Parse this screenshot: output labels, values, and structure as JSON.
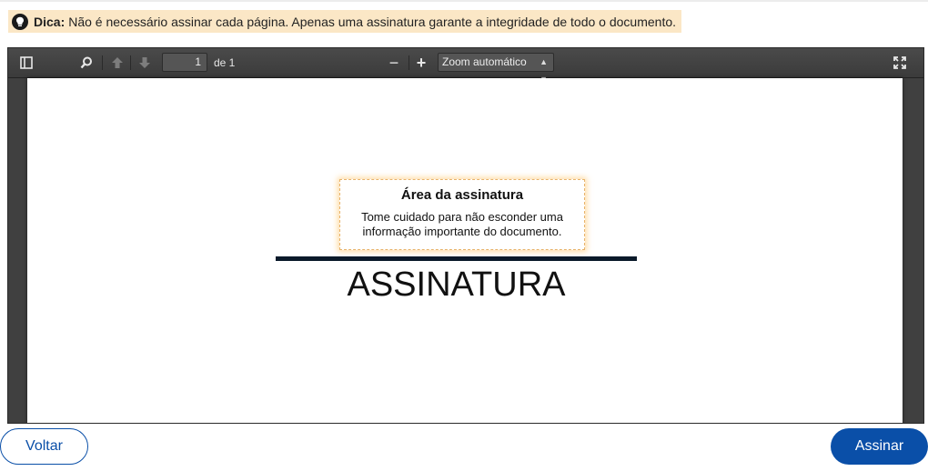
{
  "tip": {
    "label": "Dica:",
    "text": "Não é necessário assinar cada página. Apenas uma assinatura garante a integridade de todo o documento."
  },
  "viewer": {
    "icons": [
      "sidebar-toggle-icon",
      "search-icon",
      "arrow-up-icon",
      "arrow-down-icon",
      "zoom-out-icon",
      "zoom-in-icon",
      "fullscreen-icon"
    ],
    "page_number": "1",
    "page_of": "de 1",
    "zoom_minus": "−",
    "zoom_plus": "+",
    "zoom_value": "Zoom automático"
  },
  "document": {
    "signature_area_title": "Área da assinatura",
    "signature_area_desc_1": "Tome cuidado para não esconder uma",
    "signature_area_desc_2": "informação importante do documento.",
    "signature_label": "ASSINATURA"
  },
  "actions": {
    "back_label": "Voltar",
    "sign_label": "Assinar"
  },
  "colors": {
    "primary": "#0a4fa8",
    "tip_bg": "#fbe7c6",
    "viewer_bg": "#404040"
  }
}
